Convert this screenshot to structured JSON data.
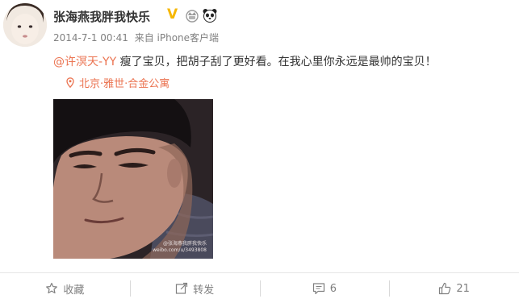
{
  "user": {
    "name": "张海燕我胖我快乐",
    "verified_mark": "V"
  },
  "meta": {
    "time": "2014-7-1 00:41",
    "source": "来自 iPhone客户端"
  },
  "post": {
    "mention": "@许溟天-YY",
    "text": " 瘦了宝贝，把胡子刮了更好看。在我心里你永远是最帅的宝贝！"
  },
  "location": {
    "label": "北京·雅世·合金公寓"
  },
  "photo": {
    "watermark_line1": "@张海燕我胖我快乐",
    "watermark_line2": "weibo.com/u/3493808"
  },
  "actions": {
    "favorite_label": "收藏",
    "repost_label": "转发",
    "comment_count": "6",
    "like_count": "21"
  },
  "colors": {
    "link": "#eb7350",
    "verified": "#f6b700",
    "meta_text": "#808080"
  }
}
